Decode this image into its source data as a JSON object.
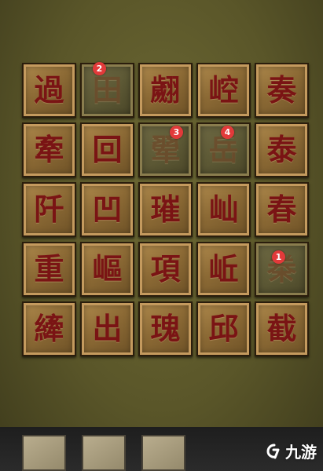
{
  "grid": [
    [
      {
        "char": "過",
        "dim": false
      },
      {
        "char": "田",
        "dim": true,
        "badge": "2"
      },
      {
        "char": "翽",
        "dim": false
      },
      {
        "char": "崆",
        "dim": false
      },
      {
        "char": "奏",
        "dim": false
      }
    ],
    [
      {
        "char": "牽",
        "dim": false
      },
      {
        "char": "回",
        "dim": false
      },
      {
        "char": "翚",
        "dim": true,
        "badge": "3"
      },
      {
        "char": "岳",
        "dim": true,
        "badge": "4"
      },
      {
        "char": "泰",
        "dim": false
      }
    ],
    [
      {
        "char": "阡",
        "dim": false
      },
      {
        "char": "凹",
        "dim": false
      },
      {
        "char": "璀",
        "dim": false
      },
      {
        "char": "屾",
        "dim": false
      },
      {
        "char": "春",
        "dim": false
      }
    ],
    [
      {
        "char": "重",
        "dim": false
      },
      {
        "char": "嶇",
        "dim": false
      },
      {
        "char": "項",
        "dim": false
      },
      {
        "char": "岴",
        "dim": false
      },
      {
        "char": "桊",
        "dim": true,
        "badge": "1"
      }
    ],
    [
      {
        "char": "縴",
        "dim": false
      },
      {
        "char": "出",
        "dim": false
      },
      {
        "char": "瑰",
        "dim": false
      },
      {
        "char": "邱",
        "dim": false
      },
      {
        "char": "截",
        "dim": false
      }
    ]
  ],
  "watermark": {
    "text": "九游"
  },
  "colors": {
    "glyph": "#7a1414",
    "badge": "#e23a3a",
    "tile": "#8c6a35",
    "tile_dim": "#5e5a36"
  }
}
